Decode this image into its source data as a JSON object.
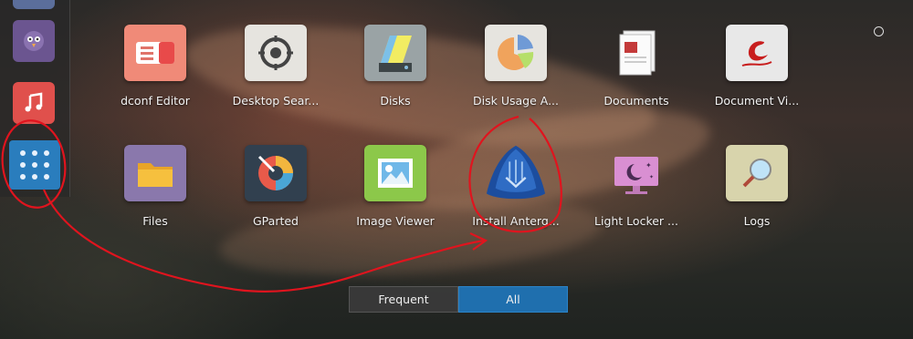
{
  "apps": [
    {
      "label": "dconf Editor",
      "icon": "dconf-editor-icon"
    },
    {
      "label": "Desktop Sear...",
      "icon": "desktop-search-icon"
    },
    {
      "label": "Disks",
      "icon": "disks-icon"
    },
    {
      "label": "Disk Usage A...",
      "icon": "disk-usage-icon"
    },
    {
      "label": "Documents",
      "icon": "documents-icon"
    },
    {
      "label": "Document Vi...",
      "icon": "document-viewer-icon"
    },
    {
      "label": "Files",
      "icon": "files-icon"
    },
    {
      "label": "GParted",
      "icon": "gparted-icon"
    },
    {
      "label": "Image Viewer",
      "icon": "image-viewer-icon"
    },
    {
      "label": "Install Anterg...",
      "icon": "install-antergos-icon"
    },
    {
      "label": "Light Locker ...",
      "icon": "light-locker-icon"
    },
    {
      "label": "Logs",
      "icon": "logs-icon"
    }
  ],
  "tabs": {
    "frequent": "Frequent",
    "all": "All",
    "active": "All"
  },
  "colors": {
    "accent": "#1f6fae",
    "annotation": "#e0141e"
  }
}
